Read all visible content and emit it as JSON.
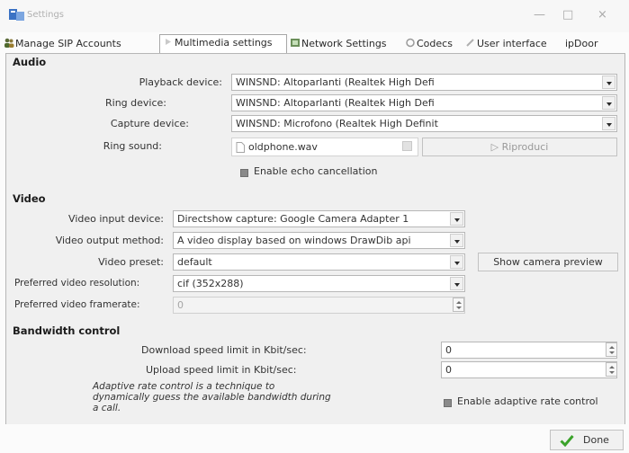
{
  "window": {
    "title": "Settings",
    "minimize": "—",
    "maximize": "□",
    "close": "×"
  },
  "tabs": [
    {
      "label": "Manage SIP Accounts"
    },
    {
      "label": "Multimedia settings"
    },
    {
      "label": "Network Settings"
    },
    {
      "label": "Codecs"
    },
    {
      "label": "User interface"
    },
    {
      "label": "ipDoor"
    }
  ],
  "audio": {
    "title": "Audio",
    "playback_label": "Playback device:",
    "playback_value": "WINSND: Altoparlanti (Realtek High Defi",
    "ring_label": "Ring device:",
    "ring_value": "WINSND: Altoparlanti (Realtek High Defi",
    "capture_label": "Capture device:",
    "capture_value": "WINSND: Microfono (Realtek High Definit",
    "ringsound_label": "Ring sound:",
    "ringsound_value": "oldphone.wav",
    "play_button": "Riproduci",
    "echo_label": "Enable echo cancellation"
  },
  "video": {
    "title": "Video",
    "input_label": "Video input device:",
    "input_value": "Directshow capture: Google Camera Adapter 1",
    "output_label": "Video output method:",
    "output_value": "A video display based on windows DrawDib api",
    "preset_label": "Video preset:",
    "preset_value": "default",
    "preview_button": "Show camera preview",
    "resolution_label": "Preferred video resolution:",
    "resolution_value": "cif (352x288)",
    "framerate_label": "Preferred video framerate:",
    "framerate_value": "0"
  },
  "bandwidth": {
    "title": "Bandwidth control",
    "download_label": "Download speed limit in Kbit/sec:",
    "download_value": "0",
    "upload_label": "Upload speed limit in Kbit/sec:",
    "upload_value": "0",
    "adaptive_note_1": "Adaptive rate control is a technique to",
    "adaptive_note_2": "dynamically guess the available bandwidth during",
    "adaptive_note_3": "a call.",
    "adaptive_label": "Enable adaptive rate control"
  },
  "footer": {
    "done": "Done"
  }
}
